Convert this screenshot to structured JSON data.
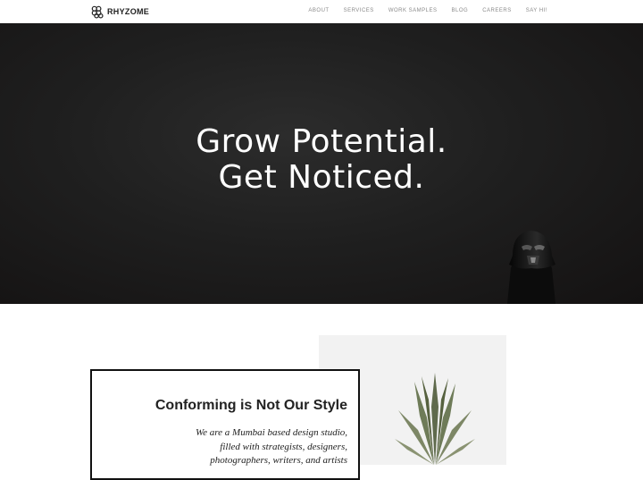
{
  "header": {
    "brand": "RHYZOME",
    "nav": [
      "ABOUT",
      "SERVICES",
      "WORK SAMPLES",
      "BLOG",
      "CAREERS",
      "SAY HI!"
    ]
  },
  "hero": {
    "line1": "Grow Potential.",
    "line2": "Get Noticed."
  },
  "about": {
    "title": "Conforming is Not Our Style",
    "lines": [
      "We are a Mumbai based design studio,",
      "filled with strategists, designers,",
      "photographers, writers, and artists"
    ]
  },
  "icons": [
    "rhyzome-logo-icon",
    "darth-vader-figure-image",
    "pineapple-image"
  ]
}
